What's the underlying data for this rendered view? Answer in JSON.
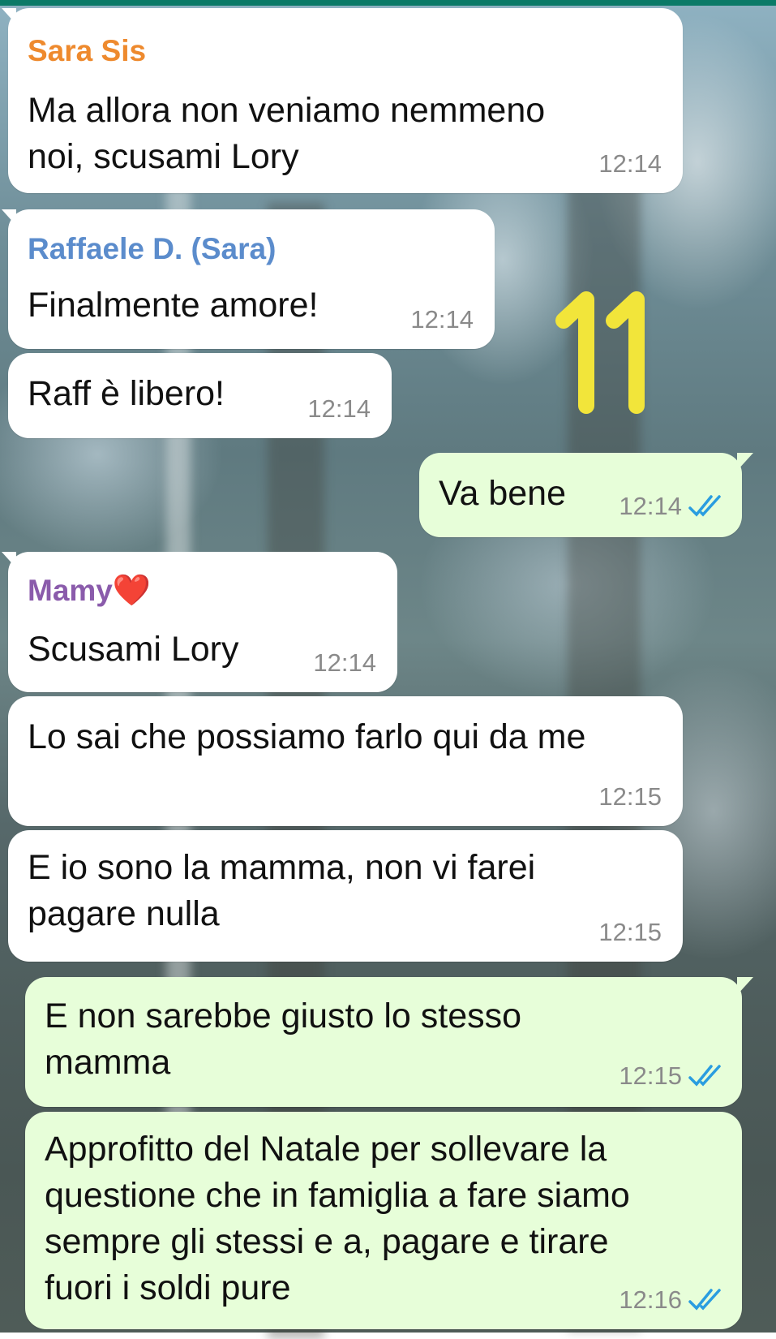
{
  "colors": {
    "incoming_bubble": "#ffffff",
    "outgoing_bubble": "#e7fed9",
    "sender_sara": "#ee8a2e",
    "sender_raffaele": "#5b8ccc",
    "sender_mamy": "#8a5bab",
    "read_ticks": "#2a9de0",
    "sticker": "#f2e53a"
  },
  "sticker": {
    "text": "11"
  },
  "messages": [
    {
      "sender": "Sara Sis",
      "text": "Ma allora non veniamo nemmeno\nnoi, scusami Lory",
      "time": "12:14"
    },
    {
      "sender": "Raffaele D. (Sara)",
      "text": "Finalmente amore!",
      "time": "12:14"
    },
    {
      "text": "Raff è libero!",
      "time": "12:14"
    },
    {
      "text": "Va bene",
      "time": "12:14",
      "status": "read"
    },
    {
      "sender": "Mamy",
      "sender_emoji": "❤️",
      "text": "Scusami Lory",
      "time": "12:14"
    },
    {
      "text": "Lo sai che possiamo farlo qui da me",
      "time": "12:15"
    },
    {
      "text": "E io sono la mamma, non vi farei\npagare nulla",
      "time": "12:15"
    },
    {
      "text": "E non sarebbe giusto lo stesso\nmamma",
      "time": "12:15",
      "status": "read"
    },
    {
      "text": "Approfitto del Natale per sollevare la\nquestione che in famiglia a fare siamo\nsempre gli stessi e a, pagare e tirare\nfuori i soldi pure",
      "time": "12:16",
      "status": "read"
    }
  ]
}
